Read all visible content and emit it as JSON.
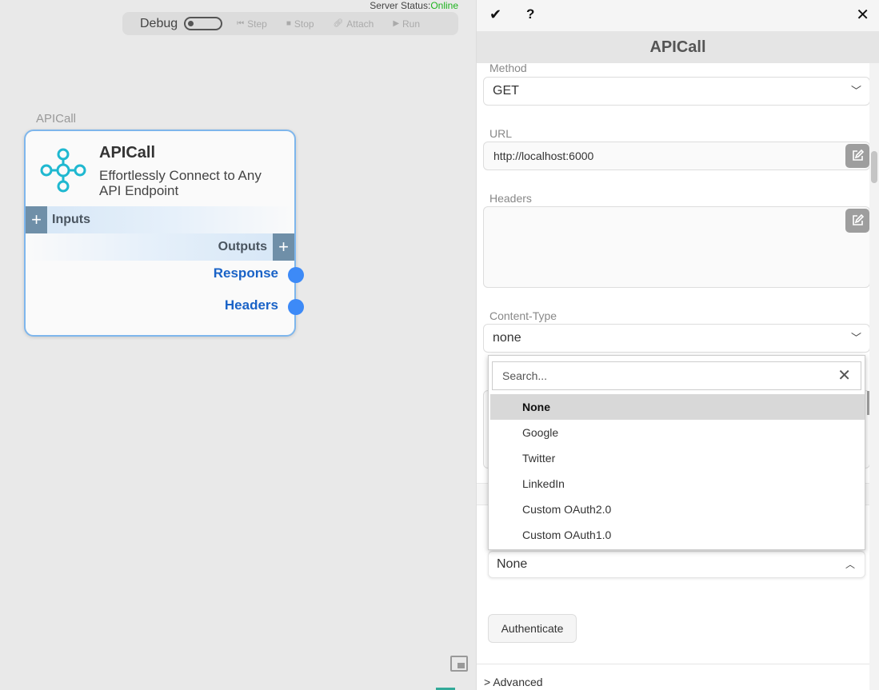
{
  "canvas": {
    "server_status_label": "Server Status:",
    "server_status_value": "Online",
    "debug_label": "Debug",
    "debug_buttons": {
      "step": "Step",
      "stop": "Stop",
      "attach": "Attach",
      "run": "Run"
    },
    "node_caption": "APICall",
    "node": {
      "title": "APICall",
      "description": "Effortlessly Connect to Any API Endpoint",
      "inputs_label": "Inputs",
      "outputs_label": "Outputs",
      "outputs": [
        "Response",
        "Headers"
      ],
      "icon": "network-hub-icon",
      "icon_color": "#1fb8d0"
    }
  },
  "panel": {
    "title": "APICall",
    "method_label": "Method",
    "method_value": "GET",
    "url_label": "URL",
    "url_value": "http://localhost:6000",
    "headers_label": "Headers",
    "headers_value": "",
    "content_type_label": "Content-Type",
    "content_type_value": "none",
    "auth_value": "None",
    "authenticate_label": "Authenticate",
    "advanced_label": "Advanced",
    "dropdown": {
      "search_placeholder": "Search...",
      "options": [
        "None",
        "Google",
        "Twitter",
        "LinkedIn",
        "Custom OAuth2.0",
        "Custom OAuth1.0"
      ],
      "selected": "None"
    }
  },
  "colors": {
    "online": "#1db31d",
    "port": "#3d8af7",
    "port_label": "#1a63c7",
    "node_border": "#7eb6ec"
  }
}
